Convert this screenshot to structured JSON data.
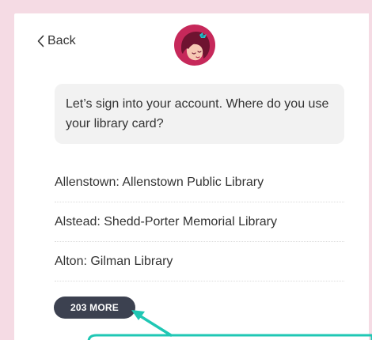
{
  "header": {
    "back_label": "Back"
  },
  "prompt": {
    "text": "Let’s sign into your account. Where do you use your library card?"
  },
  "libraries": [
    {
      "label": "Allenstown: Allenstown Public Library"
    },
    {
      "label": "Alstead: Shedd-Porter Memorial Library"
    },
    {
      "label": "Alton: Gilman Library"
    }
  ],
  "more_button": {
    "label": "203 MORE"
  },
  "colors": {
    "page_background": "#f5dbe4",
    "logo": "#c6285a",
    "button": "#3c4150",
    "annotation": "#1fc7b4"
  }
}
